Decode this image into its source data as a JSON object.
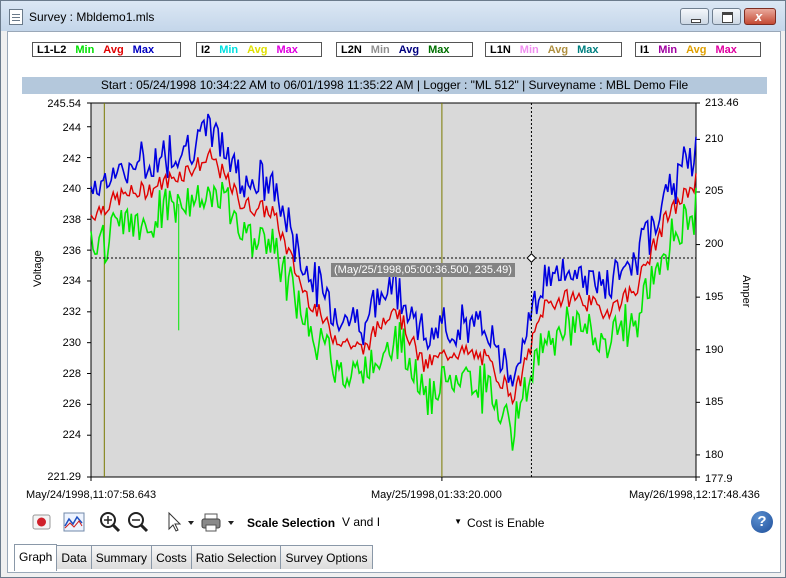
{
  "window": {
    "title": "Survey : Mbldemo1.mls"
  },
  "legends": [
    {
      "name": "L1-L2",
      "items": [
        {
          "label": "Min",
          "color": "#00e000"
        },
        {
          "label": "Avg",
          "color": "#e00000"
        },
        {
          "label": "Max",
          "color": "#0000c0"
        }
      ]
    },
    {
      "name": "I2",
      "items": [
        {
          "label": "Min",
          "color": "#00e0e0"
        },
        {
          "label": "Avg",
          "color": "#e0e000"
        },
        {
          "label": "Max",
          "color": "#e000e0"
        }
      ]
    },
    {
      "name": "L2N",
      "items": [
        {
          "label": "Min",
          "color": "#909090"
        },
        {
          "label": "Avg",
          "color": "#000080"
        },
        {
          "label": "Max",
          "color": "#007000"
        }
      ]
    },
    {
      "name": "L1N",
      "items": [
        {
          "label": "Min",
          "color": "#f090f0"
        },
        {
          "label": "Avg",
          "color": "#b09040"
        },
        {
          "label": "Max",
          "color": "#008080"
        }
      ]
    },
    {
      "name": "I1",
      "items": [
        {
          "label": "Min",
          "color": "#a000a0"
        },
        {
          "label": "Avg",
          "color": "#e0a000"
        },
        {
          "label": "Max",
          "color": "#e000a0"
        }
      ]
    }
  ],
  "banner": "Start : 05/24/1998  10:34:22 AM to 06/01/1998  11:35:22 AM | Logger : \"ML 512\" | Surveyname : MBL Demo File",
  "tooltip": "(May/25/1998,05:00:36.500, 235.49)",
  "chart_data": {
    "type": "line",
    "ylabel": "Voltage",
    "y2label": "Amper",
    "ylim": [
      221.29,
      245.54
    ],
    "y2lim": [
      177.9,
      213.46
    ],
    "y_ticks": [
      "245.54",
      "244",
      "242",
      "240",
      "238",
      "236",
      "234",
      "232",
      "230",
      "228",
      "226",
      "224",
      "221.29"
    ],
    "y2_ticks": [
      "213.46",
      "210",
      "205",
      "200",
      "195",
      "190",
      "185",
      "180",
      "177.9"
    ],
    "x_labels": [
      "May/24/1998,11:07:58.643",
      "May/25/1998,01:33:20.000",
      "May/26/1998,12:17:48.436"
    ],
    "series": [
      {
        "name": "Max",
        "color": "#0000e0"
      },
      {
        "name": "Avg",
        "color": "#e00000"
      },
      {
        "name": "Min",
        "color": "#00e000"
      }
    ],
    "x": [
      0,
      0.05,
      0.1,
      0.15,
      0.2,
      0.25,
      0.3,
      0.35,
      0.4,
      0.45,
      0.5,
      0.55,
      0.6,
      0.65,
      0.7,
      0.75,
      0.8,
      0.85,
      0.9,
      0.95,
      1.0
    ],
    "avg": [
      238.3,
      239.5,
      240.0,
      241.0,
      242.0,
      239.0,
      238.5,
      233.5,
      230.5,
      229.5,
      232.5,
      228.5,
      229.5,
      229.0,
      226.5,
      232.5,
      233.0,
      232.0,
      233.5,
      238.0,
      240.5
    ],
    "cursor": {
      "x": 0.728,
      "y": 235.49
    }
  },
  "toolbar": {
    "scale_label": "Scale Selection",
    "scale_value": "V and I",
    "cost_text": "Cost is Enable"
  },
  "tabs": [
    "Graph",
    "Data",
    "Summary",
    "Costs",
    "Ratio Selection",
    "Survey Options"
  ]
}
